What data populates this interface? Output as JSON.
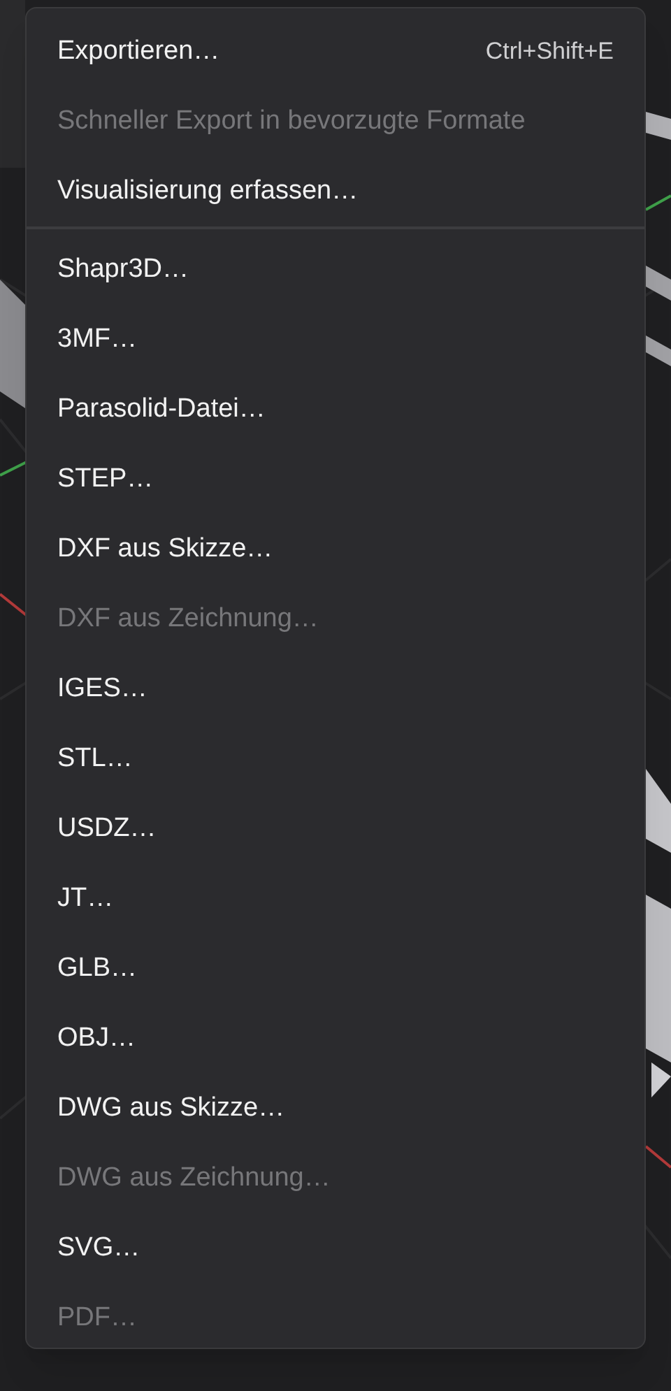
{
  "menu": {
    "sections": [
      {
        "items": [
          {
            "label": "Exportieren…",
            "shortcut": "Ctrl+Shift+E",
            "disabled": false
          },
          {
            "label": "Schneller Export in bevorzugte Formate",
            "disabled": true
          },
          {
            "label": "Visualisierung erfassen…",
            "disabled": false
          }
        ]
      },
      {
        "items": [
          {
            "label": "Shapr3D…",
            "disabled": false
          },
          {
            "label": "3MF…",
            "disabled": false
          },
          {
            "label": "Parasolid-Datei…",
            "disabled": false
          },
          {
            "label": "STEP…",
            "disabled": false
          },
          {
            "label": "DXF aus Skizze…",
            "disabled": false
          },
          {
            "label": "DXF aus Zeichnung…",
            "disabled": true
          },
          {
            "label": "IGES…",
            "disabled": false
          },
          {
            "label": "STL…",
            "disabled": false
          },
          {
            "label": "USDZ…",
            "disabled": false
          },
          {
            "label": "JT…",
            "disabled": false
          },
          {
            "label": "GLB…",
            "disabled": false
          },
          {
            "label": "OBJ…",
            "disabled": false
          },
          {
            "label": "DWG aus Skizze…",
            "disabled": false
          },
          {
            "label": "DWG aus Zeichnung…",
            "disabled": true
          },
          {
            "label": "SVG…",
            "disabled": false
          },
          {
            "label": "PDF…",
            "disabled": true
          }
        ]
      }
    ]
  }
}
